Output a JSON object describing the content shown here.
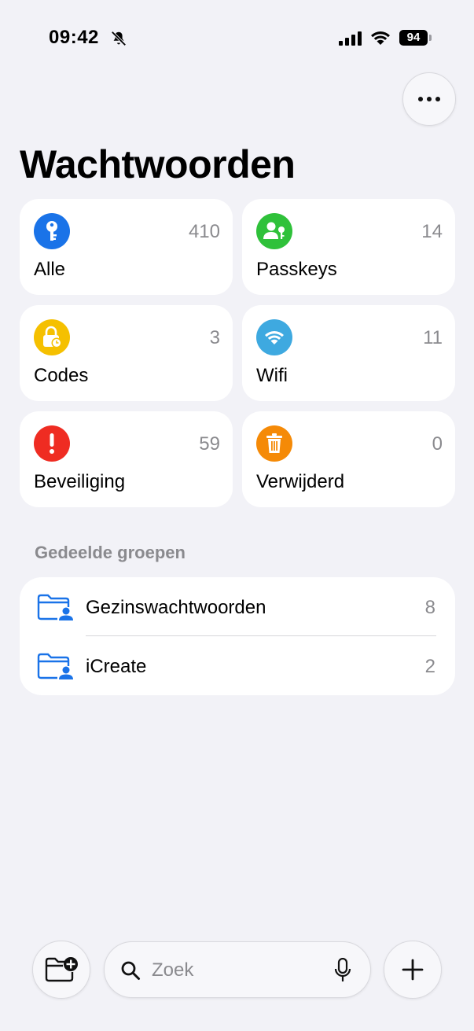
{
  "status_bar": {
    "time": "09:42",
    "battery": "94"
  },
  "header": {
    "title": "Wachtwoorden",
    "more_icon": "ellipsis-icon"
  },
  "categories": [
    {
      "label": "Alle",
      "count": "410",
      "icon": "key-icon",
      "color": "#1a73e8"
    },
    {
      "label": "Passkeys",
      "count": "14",
      "icon": "person-key-icon",
      "color": "#2fc13a"
    },
    {
      "label": "Codes",
      "count": "3",
      "icon": "lock-clock-icon",
      "color": "#f5c000"
    },
    {
      "label": "Wifi",
      "count": "11",
      "icon": "wifi-icon",
      "color": "#3ea9e0"
    },
    {
      "label": "Beveiliging",
      "count": "59",
      "icon": "exclamation-icon",
      "color": "#ef2c22"
    },
    {
      "label": "Verwijderd",
      "count": "0",
      "icon": "trash-icon",
      "color": "#f58a07"
    }
  ],
  "shared_groups": {
    "title": "Gedeelde groepen",
    "items": [
      {
        "name": "Gezinswachtwoorden",
        "count": "8",
        "icon": "shared-folder-icon"
      },
      {
        "name": "iCreate",
        "count": "2",
        "icon": "shared-folder-icon"
      }
    ]
  },
  "toolbar": {
    "new_group_icon": "folder-plus-icon",
    "search_placeholder": "Zoek",
    "mic_icon": "microphone-icon",
    "add_icon": "plus-icon"
  },
  "colors": {
    "accent": "#1a73e8",
    "background": "#f2f2f7",
    "secondary_text": "#8a8a8e"
  }
}
